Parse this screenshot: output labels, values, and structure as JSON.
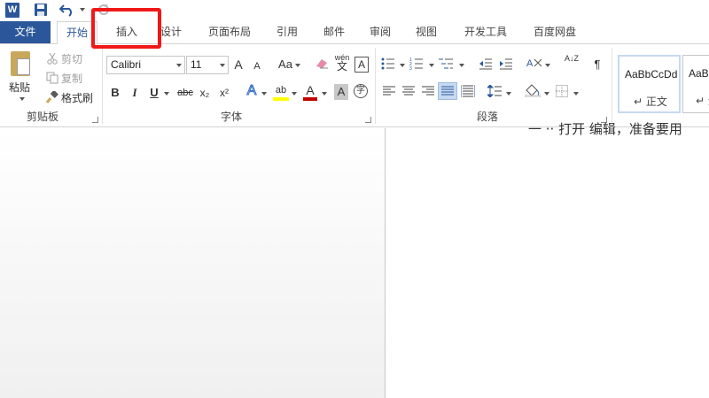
{
  "app": {
    "logo_letter": "W"
  },
  "tabs": {
    "file": "文件",
    "home": "开始",
    "insert": "插入",
    "design": "设计",
    "layout": "页面布局",
    "references": "引用",
    "mailings": "邮件",
    "review": "审阅",
    "view": "视图",
    "developer": "开发工具",
    "baidu": "百度网盘"
  },
  "clipboard": {
    "paste": "粘贴",
    "cut": "剪切",
    "copy": "复制",
    "format_painter": "格式刷",
    "group_label": "剪贴板"
  },
  "font": {
    "family": "Calibri",
    "size": "11",
    "grow": "A",
    "shrink": "A",
    "change_case": "Aa",
    "phonetic": "wén",
    "char_border": "A",
    "bold": "B",
    "italic": "I",
    "underline": "U",
    "strike": "abc",
    "subscript": "x₂",
    "superscript": "x²",
    "text_effect": "A",
    "highlight": "ab",
    "font_color": "A",
    "char_shading": "A",
    "enclose": "字",
    "group_label": "字体"
  },
  "paragraph": {
    "group_label": "段落",
    "sort": "A↓Z",
    "show_marks": "¶"
  },
  "styles": {
    "normal_preview": "AaBbCcDd",
    "normal_name": "正文",
    "nospacing_preview": "AaBbl",
    "nospacing_name": "无"
  },
  "document": {
    "visible_text": "一 ·· 打开 编辑，准备要用"
  },
  "colors": {
    "brand": "#2b579a",
    "highlight_box": "#f01818",
    "highlight_yellow": "#ffff00",
    "font_red": "#c00000"
  }
}
